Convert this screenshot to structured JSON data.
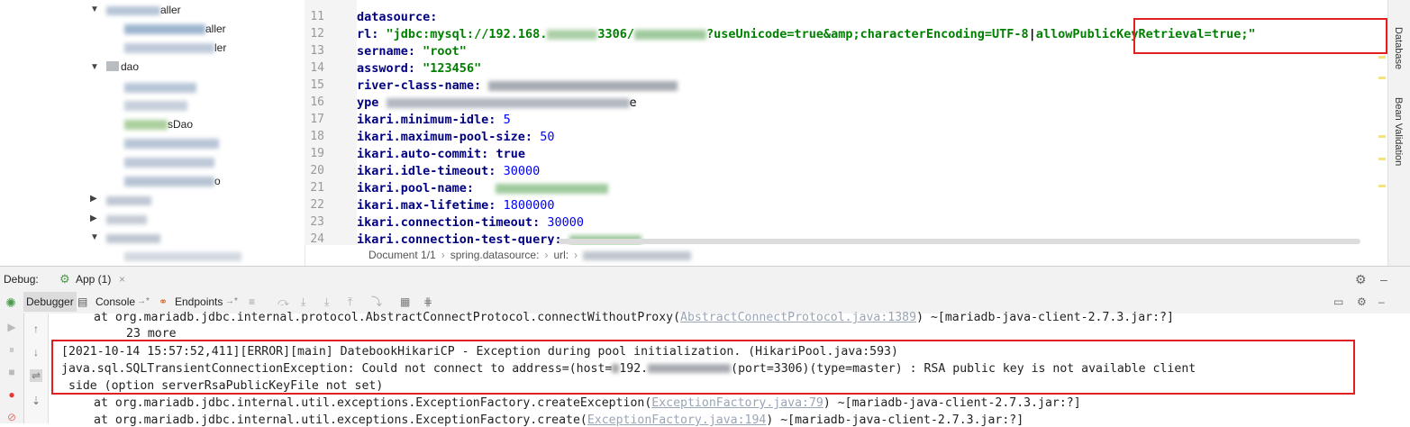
{
  "tree": {
    "rows": [
      {
        "label": "controller",
        "partial": "aller"
      },
      {
        "label": "controller",
        "partial": "aller"
      },
      {
        "label": "ler",
        "partial": "ler"
      },
      {
        "label": "dao",
        "partial": "dao"
      },
      {
        "label": "sDao",
        "partial": "sDao"
      },
      {
        "label": "o",
        "partial": "o"
      }
    ]
  },
  "editor": {
    "line_numbers": [
      "11",
      "12",
      "13",
      "14",
      "15",
      "16",
      "17",
      "18",
      "19",
      "20",
      "21",
      "22",
      "23",
      "24"
    ],
    "lines": {
      "l11": "datasource:",
      "l12_key": "rl:",
      "l12_a": "\"jdbc:mysql://192.168.",
      "l12_b": "3306/",
      "l12_c": "?useUnicode=true&amp;characterEncoding=UTF-8",
      "l12_d": "allowPublicKeyRetrieval=true;\"",
      "l13_key": "sername:",
      "l13_val": "\"root\"",
      "l14_key": "assword:",
      "l14_val": "\"123456\"",
      "l15_key": "river-class-name:",
      "l16_key": "ype",
      "l16_tail": "e",
      "l17_key": "ikari.minimum-idle:",
      "l17_val": "5",
      "l18_key": "ikari.maximum-pool-size:",
      "l18_val": "50",
      "l19_key": "ikari.auto-commit:",
      "l19_val": "true",
      "l20_key": "ikari.idle-timeout:",
      "l20_val": "30000",
      "l21_key": "ikari.pool-name:",
      "l22_key": "ikari.max-lifetime:",
      "l22_val": "1800000",
      "l23_key": "ikari.connection-timeout:",
      "l23_val": "30000",
      "l24_key": "ikari.connection-test-query:"
    },
    "breadcrumb": {
      "doc": "Document 1/1",
      "path1": "spring.datasource:",
      "path2": "url:"
    },
    "right_tabs": [
      "Database",
      "Bean Validation"
    ]
  },
  "debug": {
    "label": "Debug:",
    "run_tab": "App (1)",
    "tabs": {
      "debugger": "Debugger",
      "console": "Console",
      "endpoints": "Endpoints"
    }
  },
  "console": {
    "line0_a": "at org.mariadb.jdbc.internal.protocol.AbstractConnectProtocol.connectWithoutProxy(",
    "line0_link": "AbstractConnectProtocol.java:1389",
    "line0_b": ") ~[mariadb-java-client-2.7.3.jar:?]",
    "line1": "23 more",
    "line2": "[2021-10-14 15:57:52,411][ERROR][main] DatebookHikariCP - Exception during pool initialization. (HikariPool.java:593)",
    "line3_a": "java.sql.SQLTransientConnectionException: Could not connect to address=(host=",
    "line3_host": "192.",
    "line3_b": "(port=3306)(type=master) : RSA public key is not available client",
    "line4": " side (option serverRsaPublicKeyFile not set)",
    "line5_a": "at org.mariadb.jdbc.internal.util.exceptions.ExceptionFactory.createException(",
    "line5_link": "ExceptionFactory.java:79",
    "line5_b": ") ~[mariadb-java-client-2.7.3.jar:?]",
    "line6_a": "at org.mariadb.jdbc.internal.util.exceptions.ExceptionFactory.create(",
    "line6_link": "ExceptionFactory.java:194",
    "line6_b": ") ~[mariadb-java-client-2.7.3.jar:?]"
  }
}
